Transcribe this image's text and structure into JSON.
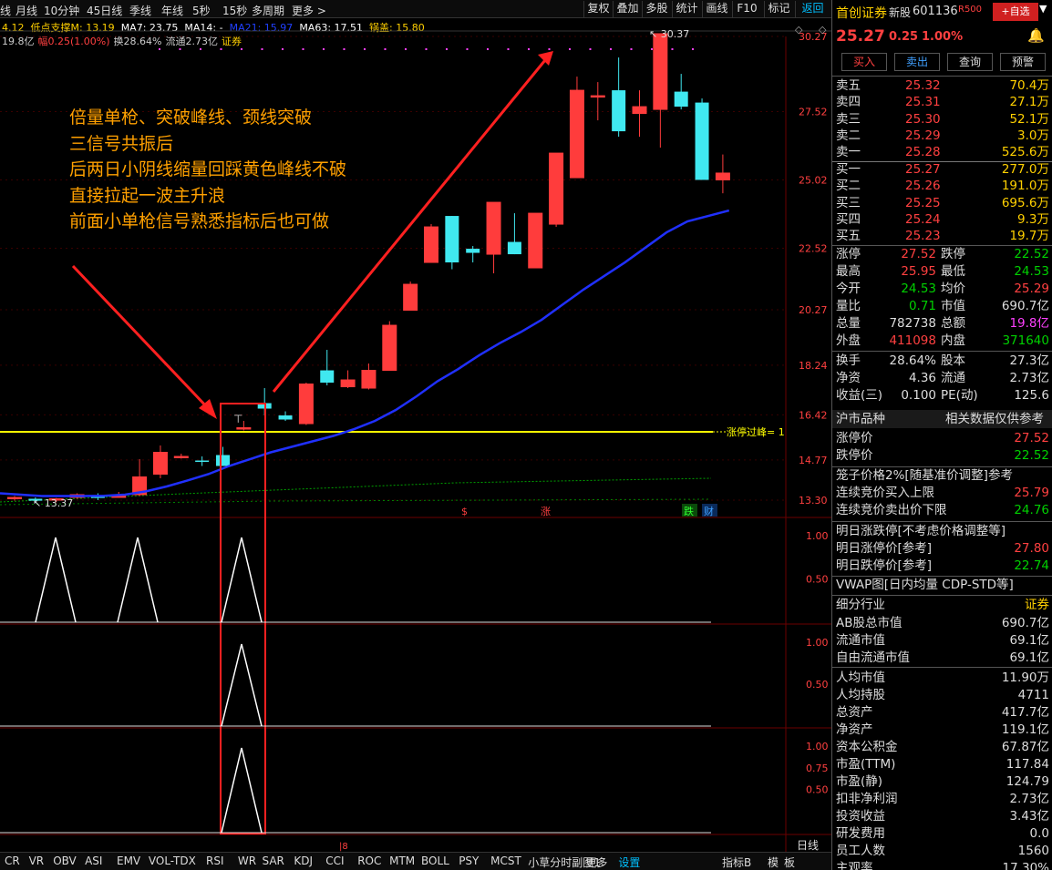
{
  "toolbar": {
    "tabs": [
      "线",
      "月线",
      "10分钟",
      "45日线",
      "季线",
      "年线",
      "5秒",
      "15秒",
      "多周期",
      "更多 >"
    ],
    "right": [
      "复权",
      "叠加",
      "多股",
      "统计",
      "画线",
      "F10",
      "标记",
      "返回"
    ]
  },
  "indicators": {
    "line1": [
      {
        "t": "4.12",
        "c": "#ffd000"
      },
      {
        "t": "低点支撑M: 13.19",
        "c": "#ffd000"
      },
      {
        "t": "MA7: 23.75",
        "c": "#ffffff"
      },
      {
        "t": "MA14: -",
        "c": "#ffffff"
      },
      {
        "t": "MA21: 15.97",
        "c": "#2040ff"
      },
      {
        "t": "MA63: 17.51",
        "c": "#ffffff"
      },
      {
        "t": "锅盖: 15.80",
        "c": "#ffd000"
      }
    ],
    "line2": [
      {
        "t": "19.8亿",
        "c": "#ccc"
      },
      {
        "t": "幅0.25(1.00%)",
        "c": "#ff4040"
      },
      {
        "t": "换28.64%",
        "c": "#ccc"
      },
      {
        "t": "流通2.73亿",
        "c": "#ccc"
      },
      {
        "t": "证券",
        "c": "#ffd000"
      }
    ]
  },
  "annotation": [
    "倍量单枪、突破峰线、颈线突破",
    "三信号共振后",
    "后两日小阴线缩量回踩黄色峰线不破",
    "直接拉起一波主升浪",
    "前面小单枪信号熟悉指标后也可做"
  ],
  "chart_data": {
    "type": "candlestick",
    "y_ticks": [
      "30.27",
      "27.52",
      "25.02",
      "22.52",
      "20.27",
      "18.24",
      "16.42",
      "14.77",
      "13.30"
    ],
    "high_label": "30.37",
    "low_label": "13.37",
    "peak_line_label": "涨停过峰= 1",
    "peak_line_value": 15.8,
    "candles": [
      {
        "o": 13.35,
        "h": 13.45,
        "l": 13.28,
        "c": 13.4
      },
      {
        "o": 13.35,
        "h": 13.4,
        "l": 13.2,
        "c": 13.28
      },
      {
        "o": 13.3,
        "h": 13.38,
        "l": 13.22,
        "c": 13.35
      },
      {
        "o": 13.4,
        "h": 13.55,
        "l": 13.35,
        "c": 13.5
      },
      {
        "o": 13.45,
        "h": 13.55,
        "l": 13.3,
        "c": 13.38
      },
      {
        "o": 13.45,
        "h": 13.6,
        "l": 13.4,
        "c": 13.45
      },
      {
        "o": 13.5,
        "h": 14.8,
        "l": 13.45,
        "c": 14.15
      },
      {
        "o": 14.25,
        "h": 15.3,
        "l": 14.1,
        "c": 15.05
      },
      {
        "o": 14.88,
        "h": 15.0,
        "l": 14.82,
        "c": 14.9
      },
      {
        "o": 14.75,
        "h": 14.9,
        "l": 14.55,
        "c": 14.7
      },
      {
        "o": 14.95,
        "h": 15.25,
        "l": 14.6,
        "c": 14.55
      },
      {
        "o": 15.95,
        "h": 16.2,
        "l": 15.85,
        "c": 15.95
      },
      {
        "o": 16.85,
        "h": 17.4,
        "l": 16.4,
        "c": 16.65
      },
      {
        "o": 16.4,
        "h": 16.55,
        "l": 16.2,
        "c": 16.25
      },
      {
        "o": 16.1,
        "h": 17.6,
        "l": 16.05,
        "c": 17.55
      },
      {
        "o": 18.05,
        "h": 18.8,
        "l": 17.5,
        "c": 17.6
      },
      {
        "o": 17.45,
        "h": 18.05,
        "l": 17.4,
        "c": 17.7
      },
      {
        "o": 17.4,
        "h": 18.3,
        "l": 17.35,
        "c": 18.05
      },
      {
        "o": 18.05,
        "h": 19.85,
        "l": 18.1,
        "c": 19.7
      },
      {
        "o": 20.25,
        "h": 21.3,
        "l": 20.3,
        "c": 21.2
      },
      {
        "o": 22.0,
        "h": 23.4,
        "l": 22.0,
        "c": 23.3
      },
      {
        "o": 23.7,
        "h": 23.7,
        "l": 21.75,
        "c": 22.0
      },
      {
        "o": 22.5,
        "h": 22.6,
        "l": 22.0,
        "c": 22.35
      },
      {
        "o": 22.3,
        "h": 24.2,
        "l": 21.6,
        "c": 24.2
      },
      {
        "o": 22.75,
        "h": 23.8,
        "l": 22.3,
        "c": 22.3
      },
      {
        "o": 21.8,
        "h": 23.6,
        "l": 21.8,
        "c": 23.8
      },
      {
        "o": 23.4,
        "h": 26.0,
        "l": 23.3,
        "c": 26.0
      },
      {
        "o": 25.1,
        "h": 28.8,
        "l": 25.1,
        "c": 28.3
      },
      {
        "o": 28.1,
        "h": 28.6,
        "l": 27.2,
        "c": 28.1
      },
      {
        "o": 28.3,
        "h": 29.5,
        "l": 26.6,
        "c": 26.8
      },
      {
        "o": 27.45,
        "h": 28.3,
        "l": 26.6,
        "c": 27.7
      },
      {
        "o": 27.6,
        "h": 30.37,
        "l": 26.2,
        "c": 30.37
      },
      {
        "o": 28.25,
        "h": 28.9,
        "l": 27.6,
        "c": 27.7
      },
      {
        "o": 27.85,
        "h": 28.0,
        "l": 25.02,
        "c": 25.02
      },
      {
        "o": 25.02,
        "h": 25.95,
        "l": 24.53,
        "c": 25.27
      }
    ]
  },
  "sub_ticks": {
    "s1": [
      "1.00",
      "0.50"
    ],
    "s2": [
      "1.00",
      "0.50"
    ],
    "s3": [
      "1.00",
      "0.75",
      "0.50"
    ]
  },
  "markers": {
    "s": "$",
    "zhang": "涨",
    "die": "跌",
    "cai": "财",
    "date_mark": "|8",
    "freq": "日线"
  },
  "bottom_tabs": [
    "CR",
    "VR",
    "OBV",
    "ASI",
    "EMV",
    "VOL-TDX",
    "RSI",
    "WR",
    "SAR",
    "KDJ",
    "CCI",
    "ROC",
    "MTM",
    "BOLL",
    "PSY",
    "MCST",
    "小草分时副图1",
    "更多",
    "设置"
  ],
  "bottom_right": [
    "指标B",
    "模",
    "板"
  ],
  "panel": {
    "name": "首创证券",
    "tag": "新股",
    "code": "601136",
    "r": "R500",
    "add": "+自选",
    "price": "25.27",
    "chg": "0.25",
    "pct": "1.00%",
    "btns": [
      "买入",
      "卖出",
      "查询",
      "预警"
    ],
    "sell": [
      [
        "卖五",
        "25.32",
        "70.4万"
      ],
      [
        "卖四",
        "25.31",
        "27.1万"
      ],
      [
        "卖三",
        "25.30",
        "52.1万"
      ],
      [
        "卖二",
        "25.29",
        "3.0万"
      ],
      [
        "卖一",
        "25.28",
        "525.6万"
      ]
    ],
    "buy": [
      [
        "买一",
        "25.27",
        "277.0万"
      ],
      [
        "买二",
        "25.26",
        "191.0万"
      ],
      [
        "买三",
        "25.25",
        "695.6万"
      ],
      [
        "买四",
        "25.24",
        "9.3万"
      ],
      [
        "买五",
        "25.23",
        "19.7万"
      ]
    ],
    "stats": [
      [
        "涨停",
        "27.52",
        "跌停",
        "22.52"
      ],
      [
        "最高",
        "25.95",
        "最低",
        "24.53"
      ],
      [
        "今开",
        "24.53",
        "均价",
        "25.29"
      ],
      [
        "量比",
        "0.71",
        "市值",
        "690.7亿"
      ],
      [
        "总量",
        "782738",
        "总额",
        "19.8亿"
      ],
      [
        "外盘",
        "411098",
        "内盘",
        "371640"
      ]
    ],
    "stats2": [
      [
        "换手",
        "28.64%",
        "股本",
        "27.3亿"
      ],
      [
        "净资",
        "4.36",
        "流通",
        "2.73亿"
      ],
      [
        "收益(三)",
        "0.100",
        "PE(动)",
        "125.6"
      ]
    ],
    "market_hd": "沪市品种",
    "market_note": "相关数据仅供参考",
    "limits": [
      [
        "涨停价",
        "27.52"
      ],
      [
        "跌停价",
        "22.52"
      ]
    ],
    "cage": "笼子价格2%[随基准价调整]参考",
    "cage_rows": [
      [
        "连续竞价买入上限",
        "25.79"
      ],
      [
        "连续竞价卖出价下限",
        "24.76"
      ]
    ],
    "tom_hd": "明日涨跌停[不考虑价格调整等]",
    "tom": [
      [
        "明日涨停价[参考]",
        "27.80"
      ],
      [
        "明日跌停价[参考]",
        "22.74"
      ]
    ],
    "vwap": "VWAP图[日内均量 CDP-STD等]",
    "ind": [
      "细分行业",
      "证券"
    ],
    "fund": [
      [
        "AB股总市值",
        "690.7亿"
      ],
      [
        "流通市值",
        "69.1亿"
      ],
      [
        "自由流通市值",
        "69.1亿"
      ],
      [
        "人均市值",
        "11.90万"
      ],
      [
        "人均持股",
        "4711"
      ],
      [
        "总资产",
        "417.7亿"
      ],
      [
        "净资产",
        "119.1亿"
      ],
      [
        "资本公积金",
        "67.87亿"
      ],
      [
        "市盈(TTM)",
        "117.84"
      ],
      [
        "市盈(静)",
        "124.79"
      ],
      [
        "扣非净利润",
        "2.73亿"
      ],
      [
        "投资收益",
        "3.43亿"
      ],
      [
        "研发费用",
        "0.0"
      ],
      [
        "员工人数",
        "1560"
      ],
      [
        "主观率",
        "17.30%"
      ]
    ]
  }
}
